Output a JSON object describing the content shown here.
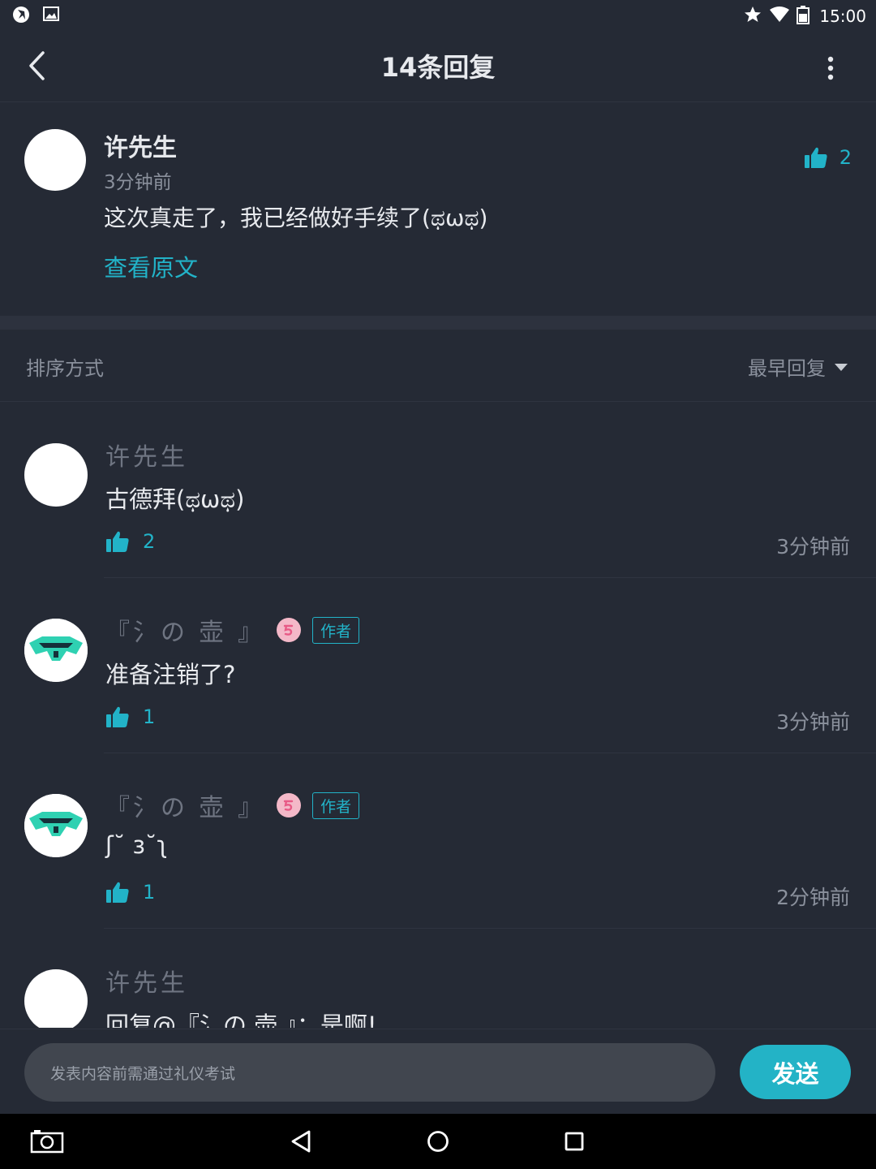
{
  "status_bar": {
    "time": "15:00"
  },
  "header": {
    "title": "14条回复"
  },
  "original_comment": {
    "author": "许先生",
    "time": "3分钟前",
    "text": "这次真走了，我已经做好手续了(ಥωಥ)",
    "view_original": "查看原文",
    "likes": "2"
  },
  "sort": {
    "label": "排序方式",
    "selected": "最早回复"
  },
  "replies": [
    {
      "author": "许先生",
      "text": "古德拜(ಥωಥ)",
      "likes": "2",
      "time": "3分钟前",
      "is_author": false
    },
    {
      "author": "『氵の 壶 』",
      "text": "准备注销了?",
      "likes": "1",
      "time": "3分钟前",
      "is_author": true,
      "tag": "作者"
    },
    {
      "author": "『氵の 壶 』",
      "text": "ʃ˘ ɜ˘ʅ",
      "likes": "1",
      "time": "2分钟前",
      "is_author": true,
      "tag": "作者"
    },
    {
      "author": "许先生",
      "text": "回复@『氵の 壶 』：是啊!",
      "likes": "",
      "time": "",
      "is_author": false
    }
  ],
  "composer": {
    "placeholder": "发表内容前需通过礼仪考试",
    "send_label": "发送"
  },
  "colors": {
    "accent": "#22b3c8",
    "background": "#252a35",
    "muted": "#8a909c"
  }
}
